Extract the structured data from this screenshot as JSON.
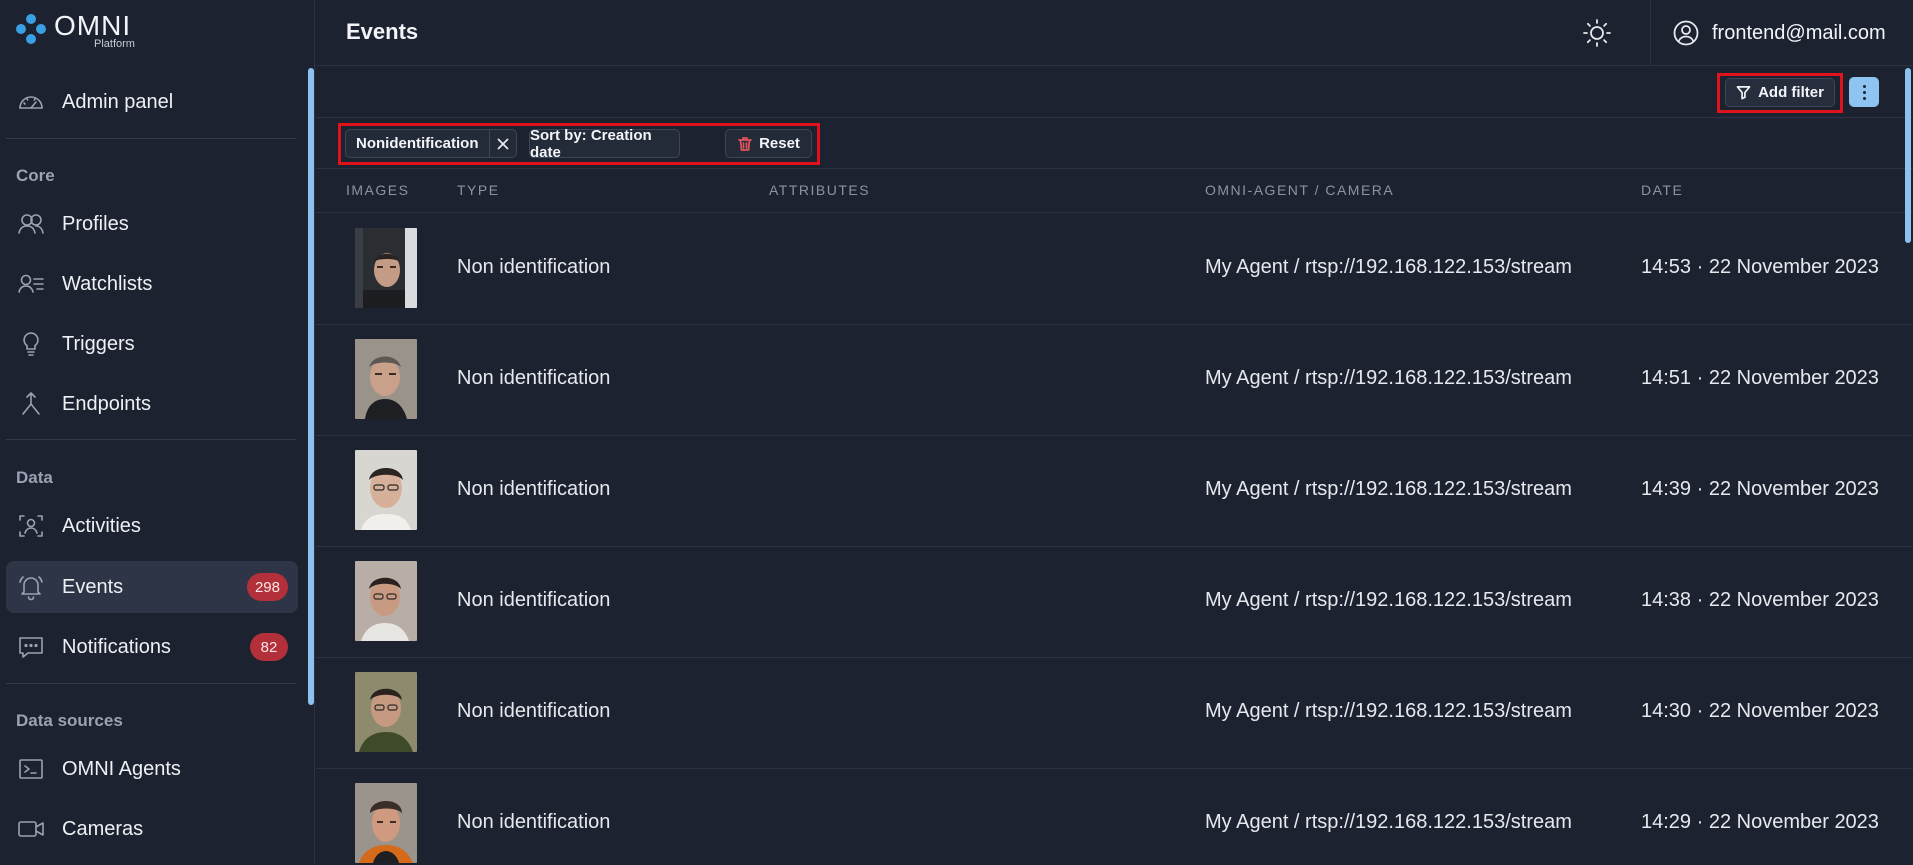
{
  "app": {
    "logo_word": "OMNI",
    "logo_sub": "Platform"
  },
  "sidebar": {
    "admin_panel": "Admin panel",
    "sections": {
      "core": "Core",
      "data": "Data",
      "data_sources": "Data sources"
    },
    "items": {
      "profiles": "Profiles",
      "watchlists": "Watchlists",
      "triggers": "Triggers",
      "endpoints": "Endpoints",
      "activities": "Activities",
      "events": "Events",
      "events_badge": "298",
      "notifications": "Notifications",
      "notifications_badge": "82",
      "omni_agents": "OMNI Agents",
      "cameras": "Cameras"
    }
  },
  "header": {
    "title": "Events",
    "user_email": "frontend@mail.com"
  },
  "toolbar": {
    "add_filter": "Add filter",
    "chip_filter": "Nonidentification",
    "chip_sort": "Sort by: Creation date",
    "chip_reset": "Reset"
  },
  "table": {
    "columns": {
      "images": "IMAGES",
      "type": "TYPE",
      "attributes": "ATTRIBUTES",
      "agent": "OMNI-AGENT / CAMERA",
      "date": "DATE"
    },
    "rows": [
      {
        "type": "Non identification",
        "agent": "My Agent / rtsp://192.168.122.153/stream",
        "date": "14:53 · 22 November 2023"
      },
      {
        "type": "Non identification",
        "agent": "My Agent / rtsp://192.168.122.153/stream",
        "date": "14:51 · 22 November 2023"
      },
      {
        "type": "Non identification",
        "agent": "My Agent / rtsp://192.168.122.153/stream",
        "date": "14:39 · 22 November 2023"
      },
      {
        "type": "Non identification",
        "agent": "My Agent / rtsp://192.168.122.153/stream",
        "date": "14:38 · 22 November 2023"
      },
      {
        "type": "Non identification",
        "agent": "My Agent / rtsp://192.168.122.153/stream",
        "date": "14:30 · 22 November 2023"
      },
      {
        "type": "Non identification",
        "agent": "My Agent / rtsp://192.168.122.153/stream",
        "date": "14:29 · 22 November 2023"
      }
    ]
  },
  "colors": {
    "background": "#1c2230",
    "accent": "#8ec4f2",
    "badge": "#b3303a",
    "highlight": "#e0121c"
  }
}
